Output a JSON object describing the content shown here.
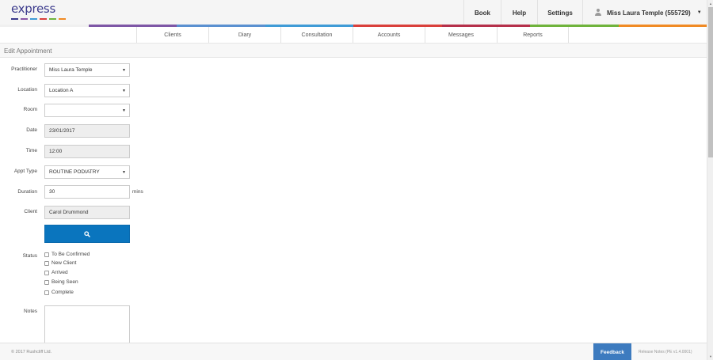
{
  "app": {
    "logo_text": "express",
    "logo_colors": [
      "#3b3a8c",
      "#8a57a8",
      "#3f9bd6",
      "#d9403b",
      "#6fb33c",
      "#f08a24"
    ]
  },
  "topnav": {
    "book": "Book",
    "help": "Help",
    "settings": "Settings",
    "user": "Miss Laura Temple (555729)"
  },
  "strip_colors": [
    "#f0f0f0",
    "#7e57a6",
    "#5a90d0",
    "#3f9bd6",
    "#d9403b",
    "#b5304a",
    "#6fb33c",
    "#f08a24"
  ],
  "subnav": {
    "tabs": [
      "Clients",
      "Diary",
      "Consultation",
      "Accounts",
      "Messages",
      "Reports"
    ]
  },
  "page": {
    "title": "Edit Appointment"
  },
  "form": {
    "practitioner": {
      "label": "Practitioner",
      "value": "Miss Laura Temple"
    },
    "location": {
      "label": "Location",
      "value": "Location A"
    },
    "room": {
      "label": "Room",
      "value": ""
    },
    "date": {
      "label": "Date",
      "value": "23/01/2017"
    },
    "time": {
      "label": "Time",
      "value": "12:00"
    },
    "appt_type": {
      "label": "Appt Type",
      "value": "ROUTINE PODIATRY"
    },
    "duration": {
      "label": "Duration",
      "value": "30",
      "unit": "mins"
    },
    "client": {
      "label": "Client",
      "value": "Carol Drummond"
    },
    "status": {
      "label": "Status",
      "options": [
        "To Be Confirmed",
        "New Client",
        "Arrived",
        "Being Seen",
        "Complete"
      ]
    },
    "notes": {
      "label": "Notes",
      "value": ""
    }
  },
  "colors": {
    "primary_button": "#0a75be",
    "feedback_button": "#3d7bbf"
  },
  "footer": {
    "copyright": "© 2017 Rushcliff Ltd.",
    "feedback": "Feedback",
    "release": "Release Notes (PE v1.4.0001)"
  }
}
